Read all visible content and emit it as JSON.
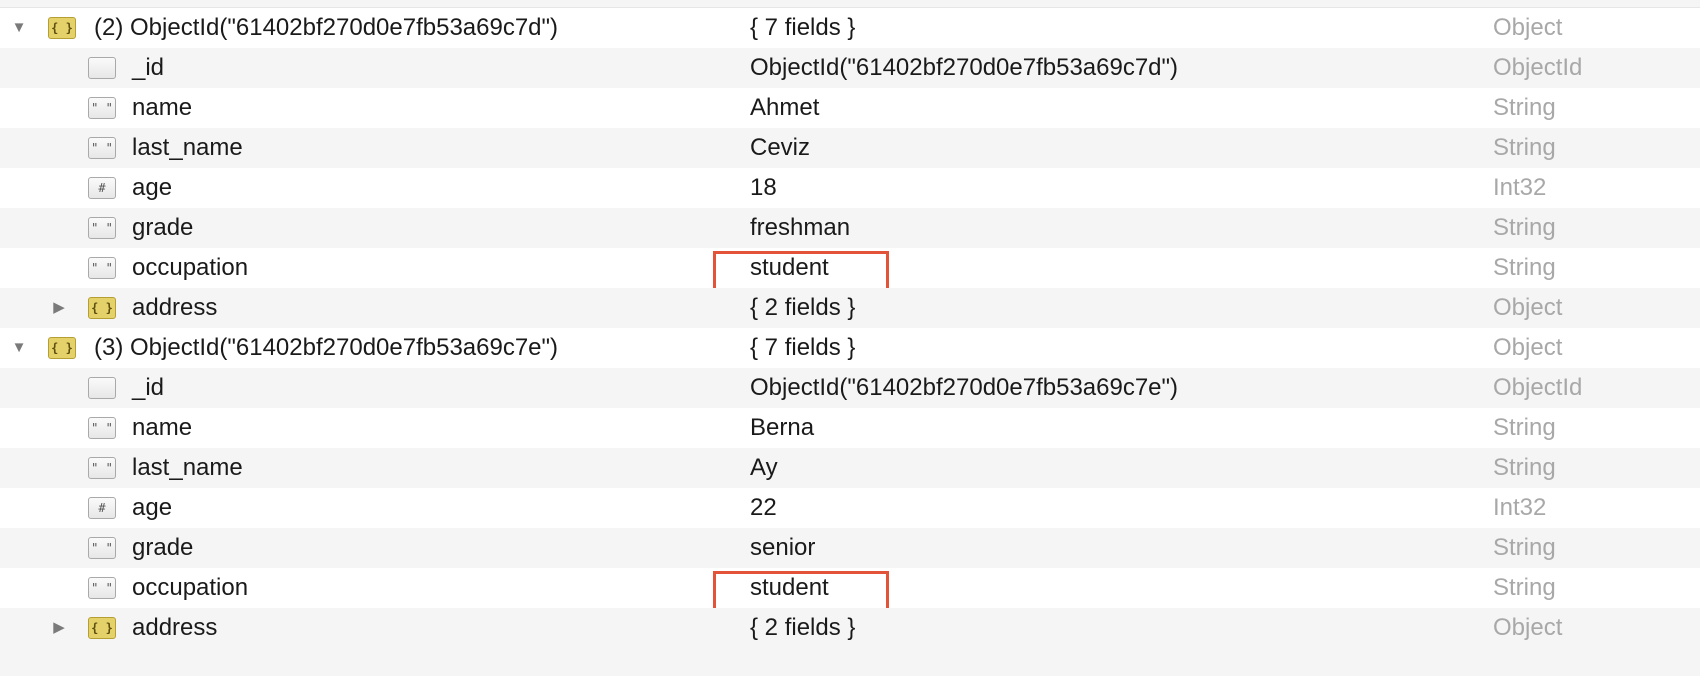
{
  "colors": {
    "highlight": "#e2533a",
    "type_text": "#a8a8a8",
    "row_alt": "#f5f5f5"
  },
  "documents": [
    {
      "header": {
        "key": "(2) ObjectId(\"61402bf270d0e7fb53a69c7d\")",
        "value": "{ 7 fields }",
        "type": "Object",
        "icon": "object-icon"
      },
      "fields": [
        {
          "key": "_id",
          "value": "ObjectId(\"61402bf270d0e7fb53a69c7d\")",
          "type": "ObjectId",
          "icon": "objectid-icon"
        },
        {
          "key": "name",
          "value": "Ahmet",
          "type": "String",
          "icon": "string-icon"
        },
        {
          "key": "last_name",
          "value": "Ceviz",
          "type": "String",
          "icon": "string-icon"
        },
        {
          "key": "age",
          "value": "18",
          "type": "Int32",
          "icon": "number-icon"
        },
        {
          "key": "grade",
          "value": "freshman",
          "type": "String",
          "icon": "string-icon"
        },
        {
          "key": "occupation",
          "value": "student",
          "type": "String",
          "icon": "string-icon"
        },
        {
          "key": "address",
          "value": "{ 2 fields }",
          "type": "Object",
          "icon": "object-icon"
        }
      ]
    },
    {
      "header": {
        "key": "(3) ObjectId(\"61402bf270d0e7fb53a69c7e\")",
        "value": "{ 7 fields }",
        "type": "Object",
        "icon": "object-icon"
      },
      "fields": [
        {
          "key": "_id",
          "value": "ObjectId(\"61402bf270d0e7fb53a69c7e\")",
          "type": "ObjectId",
          "icon": "objectid-icon"
        },
        {
          "key": "name",
          "value": "Berna",
          "type": "String",
          "icon": "string-icon"
        },
        {
          "key": "last_name",
          "value": "Ay",
          "type": "String",
          "icon": "string-icon"
        },
        {
          "key": "age",
          "value": "22",
          "type": "Int32",
          "icon": "number-icon"
        },
        {
          "key": "grade",
          "value": "senior",
          "type": "String",
          "icon": "string-icon"
        },
        {
          "key": "occupation",
          "value": "student",
          "type": "String",
          "icon": "string-icon"
        },
        {
          "key": "address",
          "value": "{ 2 fields }",
          "type": "Object",
          "icon": "object-icon"
        }
      ]
    }
  ]
}
